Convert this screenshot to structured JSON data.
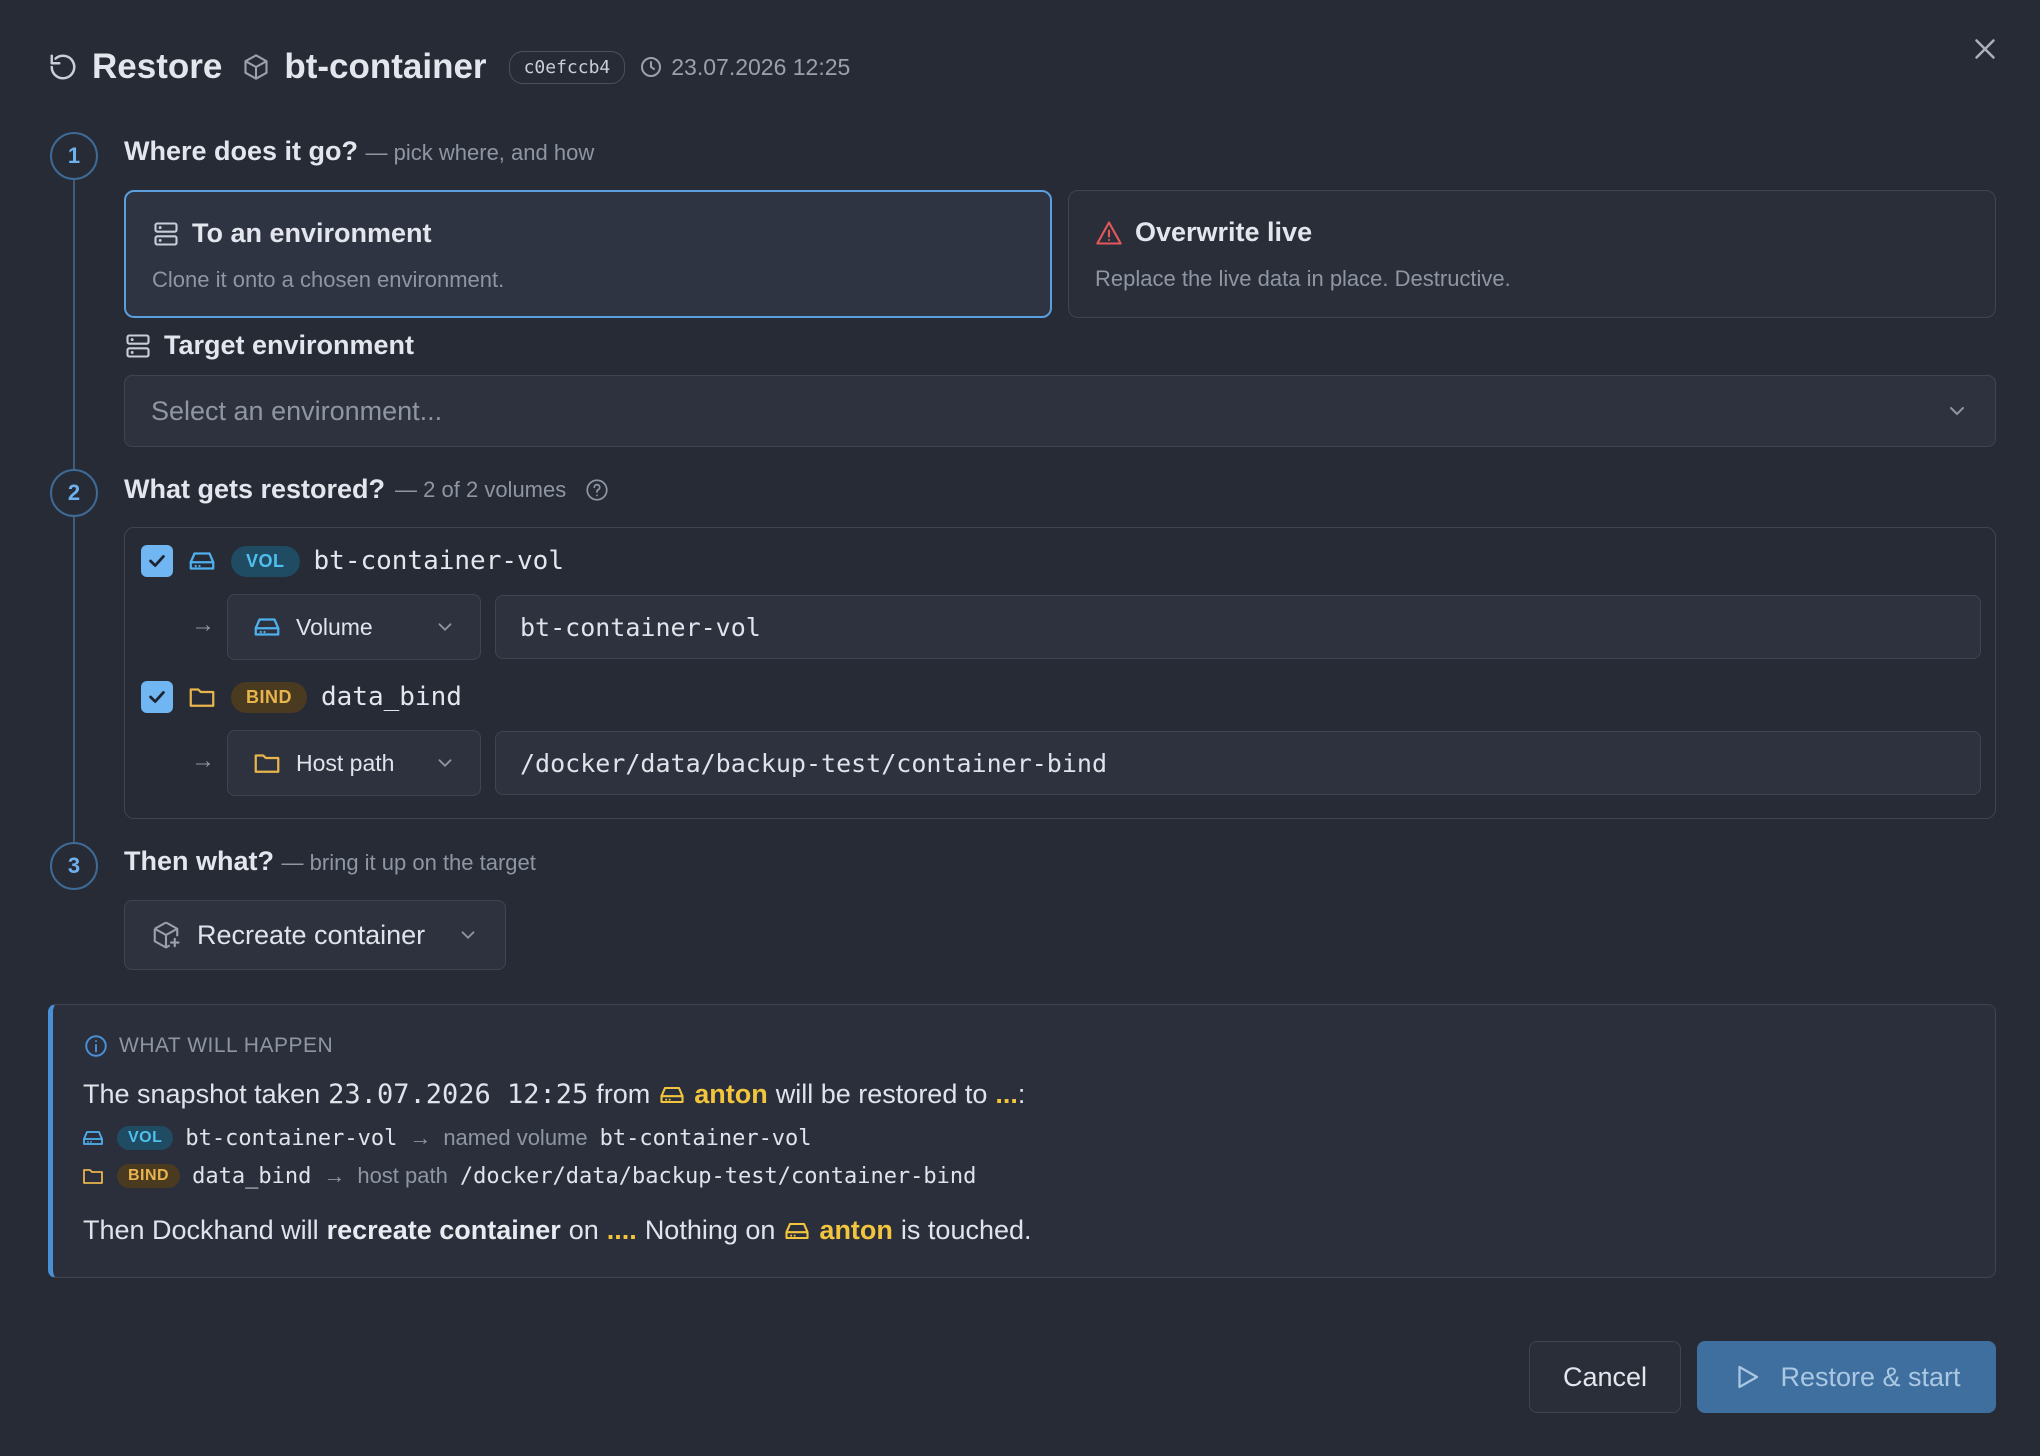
{
  "header": {
    "title": "Restore",
    "container_name": "bt-container",
    "snapshot_hash": "c0efccb4",
    "timestamp": "23.07.2026 12:25"
  },
  "steps": [
    {
      "number": "1",
      "title": "Where does it go?",
      "subtitle": "— pick where, and how"
    },
    {
      "number": "2",
      "title": "What gets restored?",
      "subtitle": "— 2 of 2 volumes"
    },
    {
      "number": "3",
      "title": "Then what?",
      "subtitle": "— bring it up on the target"
    }
  ],
  "destination_options": [
    {
      "title": "To an environment",
      "description": "Clone it onto a chosen environment.",
      "selected": true
    },
    {
      "title": "Overwrite live",
      "description": "Replace the live data in place. Destructive.",
      "selected": false
    }
  ],
  "target_environment": {
    "label": "Target environment",
    "placeholder": "Select an environment..."
  },
  "volumes": [
    {
      "checked": true,
      "badge": "VOL",
      "name": "bt-container-vol",
      "arrow": "→",
      "target_type": "Volume",
      "target_value": "bt-container-vol"
    },
    {
      "checked": true,
      "badge": "BIND",
      "name": "data_bind",
      "arrow": "→",
      "target_type": "Host path",
      "target_value": "/docker/data/backup-test/container-bind"
    }
  ],
  "then_action": "Recreate container",
  "summary": {
    "heading": "WHAT WILL HAPPEN",
    "line1_prefix": "The snapshot taken",
    "line1_time": "23.07.2026 12:25",
    "line1_from": "from",
    "source_host": "anton",
    "line1_suffix": "will be restored to",
    "target_placeholder": "...",
    "line1_colon": ":",
    "mappings": [
      {
        "badge": "VOL",
        "name": "bt-container-vol",
        "arrow": "→",
        "kind": "named volume",
        "target": "bt-container-vol"
      },
      {
        "badge": "BIND",
        "name": "data_bind",
        "arrow": "→",
        "kind": "host path",
        "target": "/docker/data/backup-test/container-bind"
      }
    ],
    "line3_prefix": "Then Dockhand will",
    "line3_action": "recreate container",
    "line3_on": "on",
    "line3_target": "....",
    "line3_mid": "Nothing on",
    "line3_host": "anton",
    "line3_suffix": "is touched."
  },
  "buttons": {
    "cancel": "Cancel",
    "restore": "Restore & start"
  },
  "colors": {
    "background": "#272b36",
    "accent": "#5b9fde",
    "primary_button": "#3f6f9e",
    "highlight": "#f3c53c",
    "danger": "#e5585a"
  }
}
